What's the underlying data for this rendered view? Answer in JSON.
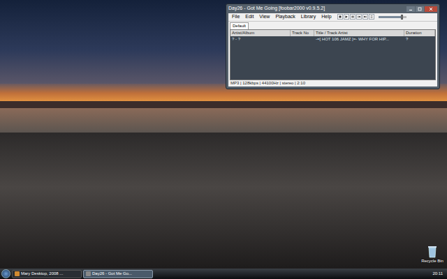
{
  "window": {
    "title": "Day26 - Got Me Going   [foobar2000 v0.9.5.2]"
  },
  "menu": [
    "File",
    "Edit",
    "View",
    "Playback",
    "Library",
    "Help"
  ],
  "volume": {
    "level": 0.85
  },
  "tabs": [
    {
      "label": "Default",
      "selected": true
    }
  ],
  "playlist": {
    "columns": [
      "Artist/Album",
      "Track No",
      "Title / Track Artist",
      "Duration"
    ],
    "rows": [
      {
        "artist_album": "? - ?",
        "title": "-=[ HOT 106 JAMZ ]=- WHY FOR HIP...",
        "duration": "?",
        "selected": false
      }
    ]
  },
  "status_bar": "MP3 | 128kbps | 44100Hz | stereo | 2:10",
  "desktop_icons": [
    {
      "label": "Recycle Bin"
    }
  ],
  "taskbar": {
    "tasks": [
      {
        "label": "Mary Desktop, 2008 ...",
        "selected": false
      },
      {
        "label": "Day26 - Got Me Go...",
        "selected": true
      }
    ],
    "clock": "20:11"
  }
}
